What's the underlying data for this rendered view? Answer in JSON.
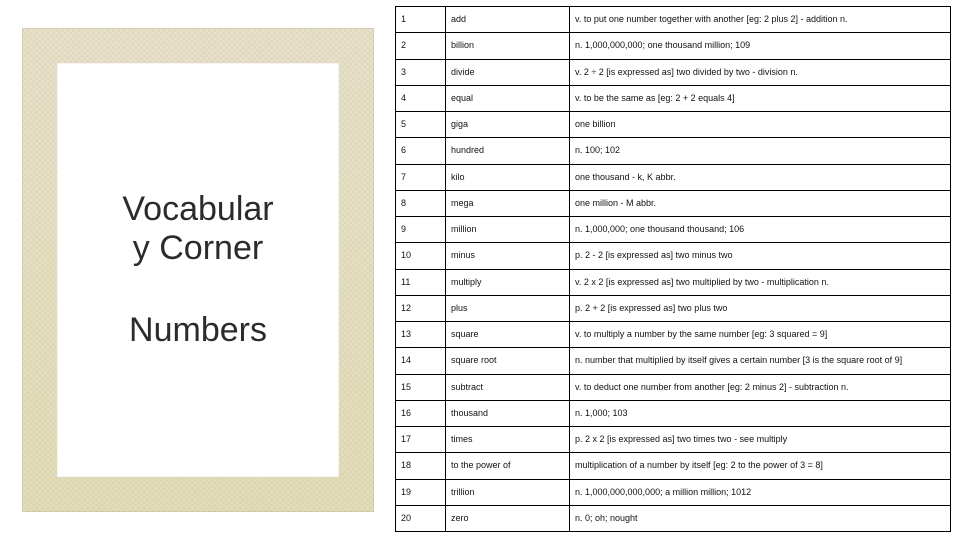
{
  "left": {
    "title_line1": "Vocabular",
    "title_line2": "y Corner",
    "subtitle": "Numbers"
  },
  "table": {
    "rows": [
      {
        "n": "1",
        "term": "add",
        "def": "v. to put one number together with another [eg: 2 plus 2] - addition n."
      },
      {
        "n": "2",
        "term": "billion",
        "def": "n. 1,000,000,000; one thousand million; 109"
      },
      {
        "n": "3",
        "term": "divide",
        "def": "v. 2 ÷ 2 [is expressed as] two divided by two - division n."
      },
      {
        "n": "4",
        "term": "equal",
        "def": "v. to be the same as [eg: 2 + 2 equals 4]"
      },
      {
        "n": "5",
        "term": "giga",
        "def": "one billion"
      },
      {
        "n": "6",
        "term": "hundred",
        "def": "n. 100; 102"
      },
      {
        "n": "7",
        "term": "kilo",
        "def": "one thousand - k, K abbr."
      },
      {
        "n": "8",
        "term": "mega",
        "def": "one million - M abbr."
      },
      {
        "n": "9",
        "term": "million",
        "def": "n. 1,000,000; one thousand thousand; 106"
      },
      {
        "n": "10",
        "term": "minus",
        "def": "p. 2 - 2 [is expressed as] two minus two"
      },
      {
        "n": "11",
        "term": "multiply",
        "def": "v. 2 x 2 [is expressed as] two multiplied by two - multiplication n."
      },
      {
        "n": "12",
        "term": "plus",
        "def": "p. 2 + 2 [is expressed as] two plus two"
      },
      {
        "n": "13",
        "term": "square",
        "def": "v. to multiply a number by the same number [eg: 3 squared = 9]"
      },
      {
        "n": "14",
        "term": "square root",
        "def": "n. number that multiplied by itself gives a certain number [3 is the square root of 9]"
      },
      {
        "n": "15",
        "term": "subtract",
        "def": "v. to deduct one number from another [eg: 2 minus 2] - subtraction n."
      },
      {
        "n": "16",
        "term": "thousand",
        "def": "n. 1,000; 103"
      },
      {
        "n": "17",
        "term": "times",
        "def": "p. 2 x 2 [is expressed as] two times two - see multiply"
      },
      {
        "n": "18",
        "term": "to the power of",
        "def": "multiplication of a number by itself [eg: 2 to the power of 3 = 8]"
      },
      {
        "n": "19",
        "term": "trillion",
        "def": "n. 1,000,000,000,000; a million million; 1012"
      },
      {
        "n": "20",
        "term": "zero",
        "def": "n. 0; oh; nought"
      }
    ]
  }
}
